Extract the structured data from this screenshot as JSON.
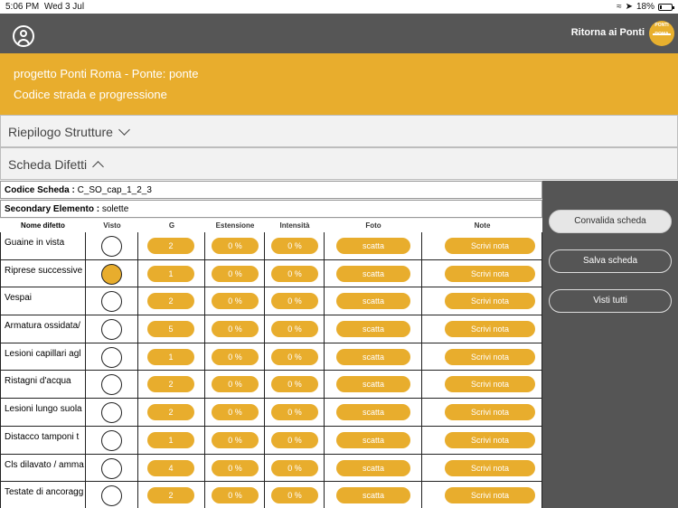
{
  "status_bar": {
    "time": "5:06 PM",
    "date": "Wed 3 Jul",
    "battery": "18%",
    "battery_level": 0.18
  },
  "nav": {
    "back_label": "Ritorna ai Ponti",
    "logo_text": "PONTI ROMA"
  },
  "project": {
    "title_line": "progetto Ponti Roma -  Ponte: ponte",
    "subtitle_line": "Codice strada e progressione"
  },
  "sections": {
    "riepilogo": "Riepilogo Strutture",
    "scheda": "Scheda Difetti"
  },
  "scheda": {
    "codice_label": "Codice Scheda :",
    "codice_value": "C_SO_cap_1_2_3",
    "secondary_label": "Secondary Elemento :",
    "secondary_value": "solette"
  },
  "table": {
    "headers": [
      "Nome difetto",
      "Visto",
      "G",
      "Estensione",
      "Intensità",
      "Foto",
      "Note"
    ],
    "rows": [
      {
        "name": "Guaine in vista",
        "checked": false,
        "g": "2",
        "est": "0 %",
        "int": "0 %",
        "foto": "scatta",
        "note": "Scrivi nota"
      },
      {
        "name": "Riprese successive",
        "checked": true,
        "g": "1",
        "est": "0 %",
        "int": "0 %",
        "foto": "scatta",
        "note": "Scrivi nota"
      },
      {
        "name": "Vespai",
        "checked": false,
        "g": "2",
        "est": "0 %",
        "int": "0 %",
        "foto": "scatta",
        "note": "Scrivi nota"
      },
      {
        "name": "Armatura ossidata/",
        "checked": false,
        "g": "5",
        "est": "0 %",
        "int": "0 %",
        "foto": "scatta",
        "note": "Scrivi nota"
      },
      {
        "name": "Lesioni capillari agl",
        "checked": false,
        "g": "1",
        "est": "0 %",
        "int": "0 %",
        "foto": "scatta",
        "note": "Scrivi nota"
      },
      {
        "name": "Ristagni d'acqua",
        "checked": false,
        "g": "2",
        "est": "0 %",
        "int": "0 %",
        "foto": "scatta",
        "note": "Scrivi nota"
      },
      {
        "name": "Lesioni lungo suola",
        "checked": false,
        "g": "2",
        "est": "0 %",
        "int": "0 %",
        "foto": "scatta",
        "note": "Scrivi nota"
      },
      {
        "name": "Distacco tamponi t",
        "checked": false,
        "g": "1",
        "est": "0 %",
        "int": "0 %",
        "foto": "scatta",
        "note": "Scrivi nota"
      },
      {
        "name": "Cls dilavato / amma",
        "checked": false,
        "g": "4",
        "est": "0 %",
        "int": "0 %",
        "foto": "scatta",
        "note": "Scrivi nota"
      },
      {
        "name": "Testate di ancoragg",
        "checked": false,
        "g": "2",
        "est": "0 %",
        "int": "0 %",
        "foto": "scatta",
        "note": "Scrivi nota"
      }
    ]
  },
  "actions": {
    "validate": "Convalida scheda",
    "save": "Salva scheda",
    "all_seen": "Visti tutti"
  },
  "colors": {
    "accent": "#e8ad2d",
    "navbar": "#565656",
    "panel": "#555555"
  }
}
